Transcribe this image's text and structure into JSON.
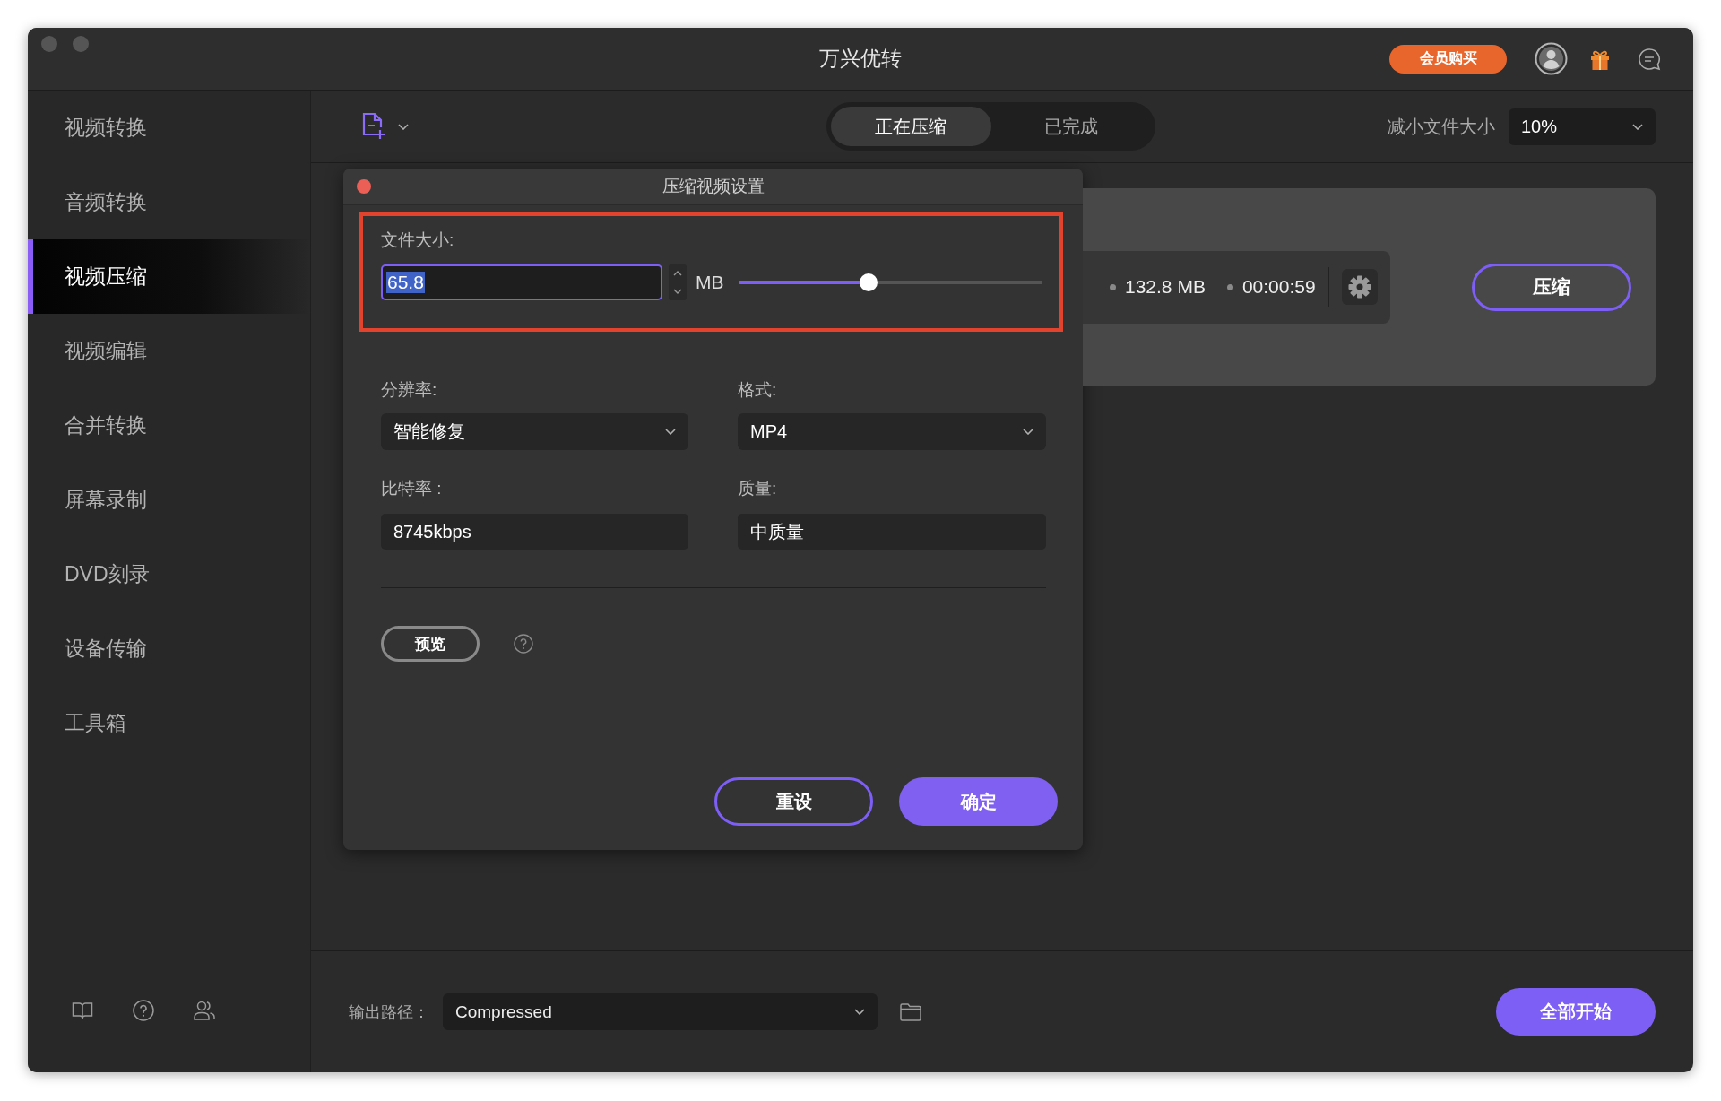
{
  "window": {
    "title": "万兴优转"
  },
  "header": {
    "purchase_button": "会员购买"
  },
  "sidebar": {
    "items": [
      {
        "label": "视频转换",
        "selected": false
      },
      {
        "label": "音频转换",
        "selected": false
      },
      {
        "label": "视频压缩",
        "selected": true
      },
      {
        "label": "视频编辑",
        "selected": false
      },
      {
        "label": "合并转换",
        "selected": false
      },
      {
        "label": "屏幕录制",
        "selected": false
      },
      {
        "label": "DVD刻录",
        "selected": false
      },
      {
        "label": "设备传输",
        "selected": false
      },
      {
        "label": "工具箱",
        "selected": false
      }
    ]
  },
  "toolbar": {
    "tabs": [
      {
        "label": "正在压缩",
        "selected": true
      },
      {
        "label": "已完成",
        "selected": false
      }
    ],
    "reduce_label": "减小文件大小",
    "reduce_select": {
      "value": "10%"
    }
  },
  "task_card": {
    "size": "132.8 MB",
    "duration": "00:00:59",
    "compress_button": "压缩"
  },
  "dialog": {
    "title": "压缩视频设置",
    "file_size": {
      "label": "文件大小:",
      "value": "65.8",
      "focused": true,
      "text_selected": true,
      "unit": "MB",
      "level": 0.43,
      "highlighted": true
    },
    "fields": [
      {
        "kind": "select",
        "label": "分辨率:",
        "value": "智能修复"
      },
      {
        "kind": "select",
        "label": "格式:",
        "value": "MP4"
      },
      {
        "kind": "readonly",
        "label": "比特率 :",
        "value": "8745kbps"
      },
      {
        "kind": "readonly",
        "label": "质量:",
        "value": "中质量"
      }
    ],
    "preview_button": "预览",
    "buttons": [
      {
        "kind": "outline",
        "label": "重设"
      },
      {
        "kind": "primary",
        "label": "确定"
      }
    ]
  },
  "bottom_bar": {
    "output_label": "输出路径：",
    "output_select": {
      "value": "Compressed"
    },
    "start_all_button": "全部开始"
  }
}
